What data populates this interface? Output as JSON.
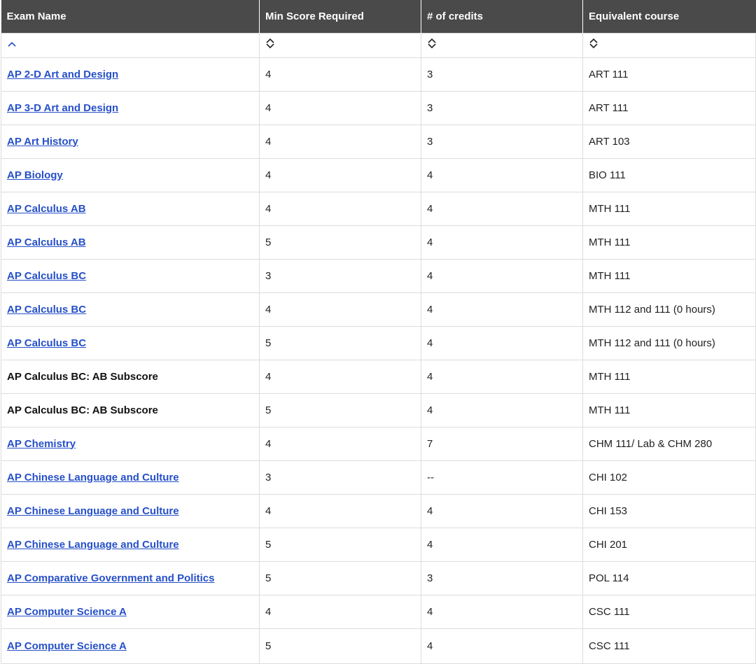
{
  "columns": [
    {
      "label": "Exam Name"
    },
    {
      "label": "Min Score Required"
    },
    {
      "label": "# of credits"
    },
    {
      "label": "Equivalent course"
    }
  ],
  "sort": {
    "active_column": "Exam Name",
    "direction": "ascending",
    "icons": [
      "sort-ascending-icon",
      "sort-both-icon",
      "sort-both-icon",
      "sort-both-icon"
    ],
    "active_color": "#2650c8"
  },
  "colors": {
    "header_bg": "#4a4a4a",
    "link": "#2650c8",
    "border": "#dcdcdc"
  },
  "rows": [
    {
      "exam": "AP 2-D Art and Design",
      "link": true,
      "min_score": "4",
      "credits": "3",
      "course": "ART 111"
    },
    {
      "exam": "AP 3-D Art and Design",
      "link": true,
      "min_score": "4",
      "credits": "3",
      "course": "ART 111"
    },
    {
      "exam": "AP Art History",
      "link": true,
      "min_score": "4",
      "credits": "3",
      "course": "ART 103"
    },
    {
      "exam": "AP Biology",
      "link": true,
      "min_score": "4",
      "credits": "4",
      "course": "BIO 111"
    },
    {
      "exam": "AP Calculus AB",
      "link": true,
      "min_score": "4",
      "credits": "4",
      "course": "MTH 111"
    },
    {
      "exam": "AP Calculus AB",
      "link": true,
      "min_score": "5",
      "credits": "4",
      "course": "MTH 111"
    },
    {
      "exam": "AP Calculus BC",
      "link": true,
      "min_score": "3",
      "credits": "4",
      "course": "MTH 111"
    },
    {
      "exam": "AP Calculus BC",
      "link": true,
      "min_score": "4",
      "credits": "4",
      "course": "MTH 112 and 111 (0 hours)"
    },
    {
      "exam": "AP Calculus BC",
      "link": true,
      "min_score": "5",
      "credits": "4",
      "course": "MTH 112 and 111 (0 hours)"
    },
    {
      "exam": "AP Calculus BC: AB Subscore",
      "link": false,
      "min_score": "4",
      "credits": "4",
      "course": "MTH 111"
    },
    {
      "exam": "AP Calculus BC: AB Subscore",
      "link": false,
      "min_score": "5",
      "credits": "4",
      "course": "MTH 111"
    },
    {
      "exam": "AP Chemistry",
      "link": true,
      "min_score": "4",
      "credits": "7",
      "course": "CHM 111/ Lab & CHM 280"
    },
    {
      "exam": "AP Chinese Language and Culture",
      "link": true,
      "min_score": "3",
      "credits": "--",
      "course": "CHI 102"
    },
    {
      "exam": "AP Chinese Language and Culture",
      "link": true,
      "min_score": "4",
      "credits": "4",
      "course": "CHI 153"
    },
    {
      "exam": "AP Chinese Language and Culture",
      "link": true,
      "min_score": "5",
      "credits": "4",
      "course": "CHI 201"
    },
    {
      "exam": "AP Comparative Government and Politics",
      "link": true,
      "min_score": "5",
      "credits": "3",
      "course": "POL 114"
    },
    {
      "exam": "AP Computer Science A",
      "link": true,
      "min_score": "4",
      "credits": "4",
      "course": "CSC 111"
    },
    {
      "exam": "AP Computer Science A",
      "link": true,
      "min_score": "5",
      "credits": "4",
      "course": "CSC 111"
    }
  ]
}
